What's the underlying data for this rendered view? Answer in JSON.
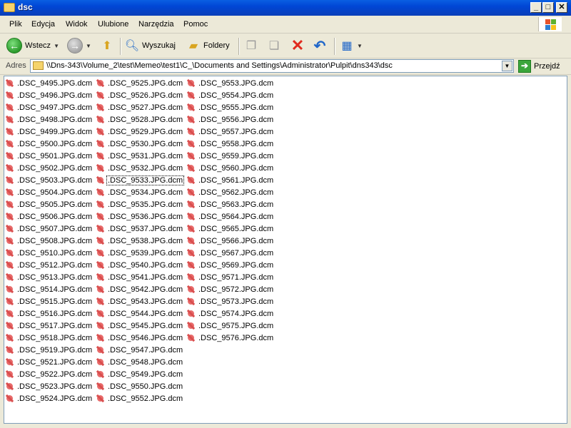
{
  "window": {
    "title": "dsc",
    "buttons": {
      "minimize": "_",
      "maximize": "□",
      "close": "✕"
    }
  },
  "menu": [
    "Plik",
    "Edycja",
    "Widok",
    "Ulubione",
    "Narzędzia",
    "Pomoc"
  ],
  "toolbar": {
    "back_label": "Wstecz",
    "search_label": "Wyszukaj",
    "folders_label": "Foldery",
    "icons": [
      "back-icon",
      "forward-icon",
      "folder-up-icon",
      "search-icon",
      "folders-icon",
      "move-to-icon",
      "copy-to-icon",
      "delete-icon",
      "undo-icon",
      "views-icon"
    ]
  },
  "address": {
    "label": "Adres",
    "path": "\\\\Dns-343\\Volume_2\\test\\Memeo\\test1\\C_\\Documents and Settings\\Administrator\\Pulpit\\dns343\\dsc",
    "go_label": "Przejdź"
  },
  "files": {
    "columns": [
      [
        ".DSC_9495.JPG.dcm",
        ".DSC_9496.JPG.dcm",
        ".DSC_9497.JPG.dcm",
        ".DSC_9498.JPG.dcm",
        ".DSC_9499.JPG.dcm",
        ".DSC_9500.JPG.dcm",
        ".DSC_9501.JPG.dcm",
        ".DSC_9502.JPG.dcm",
        ".DSC_9503.JPG.dcm",
        ".DSC_9504.JPG.dcm",
        ".DSC_9505.JPG.dcm",
        ".DSC_9506.JPG.dcm",
        ".DSC_9507.JPG.dcm",
        ".DSC_9508.JPG.dcm",
        ".DSC_9510.JPG.dcm",
        ".DSC_9512.JPG.dcm",
        ".DSC_9513.JPG.dcm",
        ".DSC_9514.JPG.dcm",
        ".DSC_9515.JPG.dcm",
        ".DSC_9516.JPG.dcm",
        ".DSC_9517.JPG.dcm",
        ".DSC_9518.JPG.dcm",
        ".DSC_9519.JPG.dcm",
        ".DSC_9521.JPG.dcm",
        ".DSC_9522.JPG.dcm",
        ".DSC_9523.JPG.dcm",
        ".DSC_9524.JPG.dcm"
      ],
      [
        ".DSC_9525.JPG.dcm",
        ".DSC_9526.JPG.dcm",
        ".DSC_9527.JPG.dcm",
        ".DSC_9528.JPG.dcm",
        ".DSC_9529.JPG.dcm",
        ".DSC_9530.JPG.dcm",
        ".DSC_9531.JPG.dcm",
        ".DSC_9532.JPG.dcm",
        ".DSC_9533.JPG.dcm",
        ".DSC_9534.JPG.dcm",
        ".DSC_9535.JPG.dcm",
        ".DSC_9536.JPG.dcm",
        ".DSC_9537.JPG.dcm",
        ".DSC_9538.JPG.dcm",
        ".DSC_9539.JPG.dcm",
        ".DSC_9540.JPG.dcm",
        ".DSC_9541.JPG.dcm",
        ".DSC_9542.JPG.dcm",
        ".DSC_9543.JPG.dcm",
        ".DSC_9544.JPG.dcm",
        ".DSC_9545.JPG.dcm",
        ".DSC_9546.JPG.dcm",
        ".DSC_9547.JPG.dcm",
        ".DSC_9548.JPG.dcm",
        ".DSC_9549.JPG.dcm",
        ".DSC_9550.JPG.dcm",
        ".DSC_9552.JPG.dcm"
      ],
      [
        ".DSC_9553.JPG.dcm",
        ".DSC_9554.JPG.dcm",
        ".DSC_9555.JPG.dcm",
        ".DSC_9556.JPG.dcm",
        ".DSC_9557.JPG.dcm",
        ".DSC_9558.JPG.dcm",
        ".DSC_9559.JPG.dcm",
        ".DSC_9560.JPG.dcm",
        ".DSC_9561.JPG.dcm",
        ".DSC_9562.JPG.dcm",
        ".DSC_9563.JPG.dcm",
        ".DSC_9564.JPG.dcm",
        ".DSC_9565.JPG.dcm",
        ".DSC_9566.JPG.dcm",
        ".DSC_9567.JPG.dcm",
        ".DSC_9569.JPG.dcm",
        ".DSC_9571.JPG.dcm",
        ".DSC_9572.JPG.dcm",
        ".DSC_9573.JPG.dcm",
        ".DSC_9574.JPG.dcm",
        ".DSC_9575.JPG.dcm",
        ".DSC_9576.JPG.dcm"
      ]
    ],
    "focused": ".DSC_9533.JPG.dcm"
  },
  "colors": {
    "titlebar": "#0046D5",
    "window_bg": "#ECE9D8",
    "file_icon": "#E86A6A"
  }
}
